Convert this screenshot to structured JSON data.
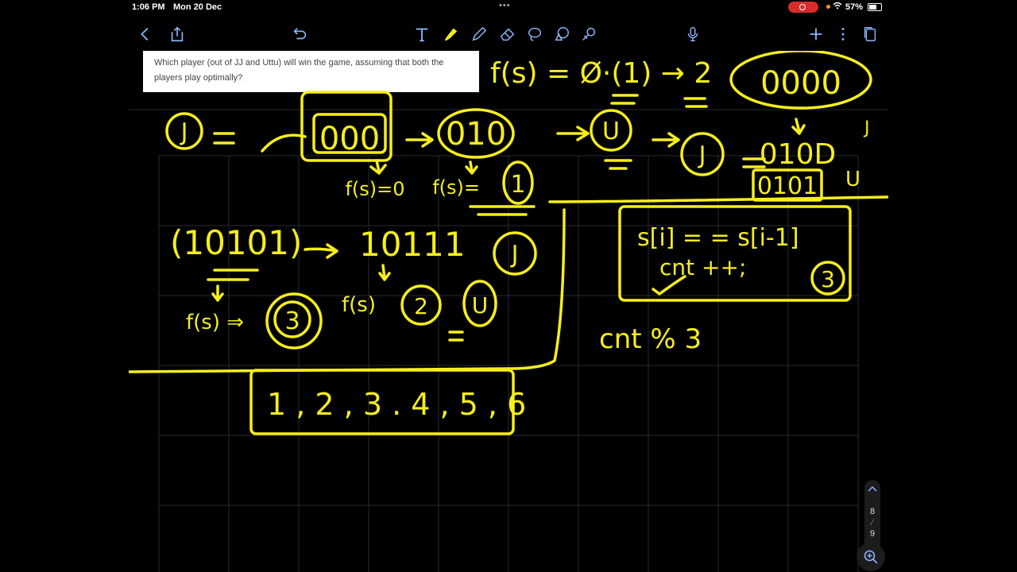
{
  "status": {
    "time": "1:06 PM",
    "date": "Mon 20 Dec",
    "battery": "57%"
  },
  "toolbar": {
    "left": [
      "back-icon",
      "share-icon"
    ],
    "center": [
      "undo-icon",
      "text-tool-icon",
      "highlighter-icon",
      "pen-icon",
      "eraser-icon",
      "lasso-icon",
      "shapes-icon",
      "laser-icon"
    ],
    "right": [
      "microphone-icon",
      "add-icon",
      "more-icon",
      "pages-icon"
    ],
    "accent": "#f5ee1c"
  },
  "question": {
    "text": "Which player (out of JJ and Uttu) will win the game, assuming that both the players play optimally?"
  },
  "notes": {
    "ink_color": "#f5ee1c",
    "line1_left": "J =",
    "box1": "000",
    "box2": "010",
    "u_circle": "U",
    "j_circle": "J",
    "f_eq_zero": "f(s)=0",
    "f_eq_one": "f(s)=",
    "one_circle": "1",
    "top_formula": "f(s) = Ø·(1) → 2",
    "stacked": "0000",
    "binary_a": "010D",
    "binary_b": "0101",
    "J_small": "J",
    "U_small": "U",
    "seq_left": "(10101)",
    "seq_right": "10111",
    "j_circle2": "J",
    "f_three": "f(s) ⇒",
    "three_circle": "3",
    "f_two": "f(s)",
    "two_circle": "2",
    "u_circle2": "U",
    "code_line1": "s[i] = = s[i-1]",
    "code_line2": "cnt ++;",
    "three_circle2": "3",
    "cnt_mod": "cnt % 3",
    "number_list": "1 , 2 , 3 . 4 , 5 , 6"
  },
  "pager": {
    "current": "8",
    "total": "9"
  }
}
